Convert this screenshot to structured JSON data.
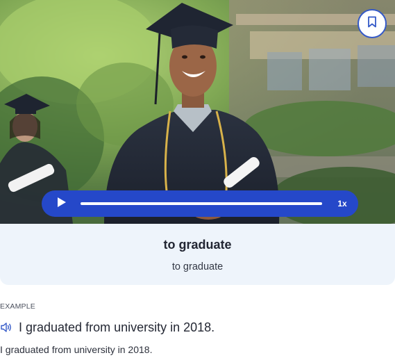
{
  "hero": {
    "image_label": "graduation photo"
  },
  "player": {
    "speed": "1x",
    "progress": 1.0
  },
  "term": {
    "title": "to graduate",
    "translation": "to graduate"
  },
  "example": {
    "label": "EXAMPLE",
    "sentence": "I graduated from university in 2018.",
    "translation": "I graduated from university in 2018."
  },
  "icons": {
    "bookmark": "bookmark-icon",
    "play": "play-icon",
    "speaker": "speaker-icon"
  },
  "colors": {
    "accent": "#2548c9",
    "card_background": "#eef4fb"
  }
}
